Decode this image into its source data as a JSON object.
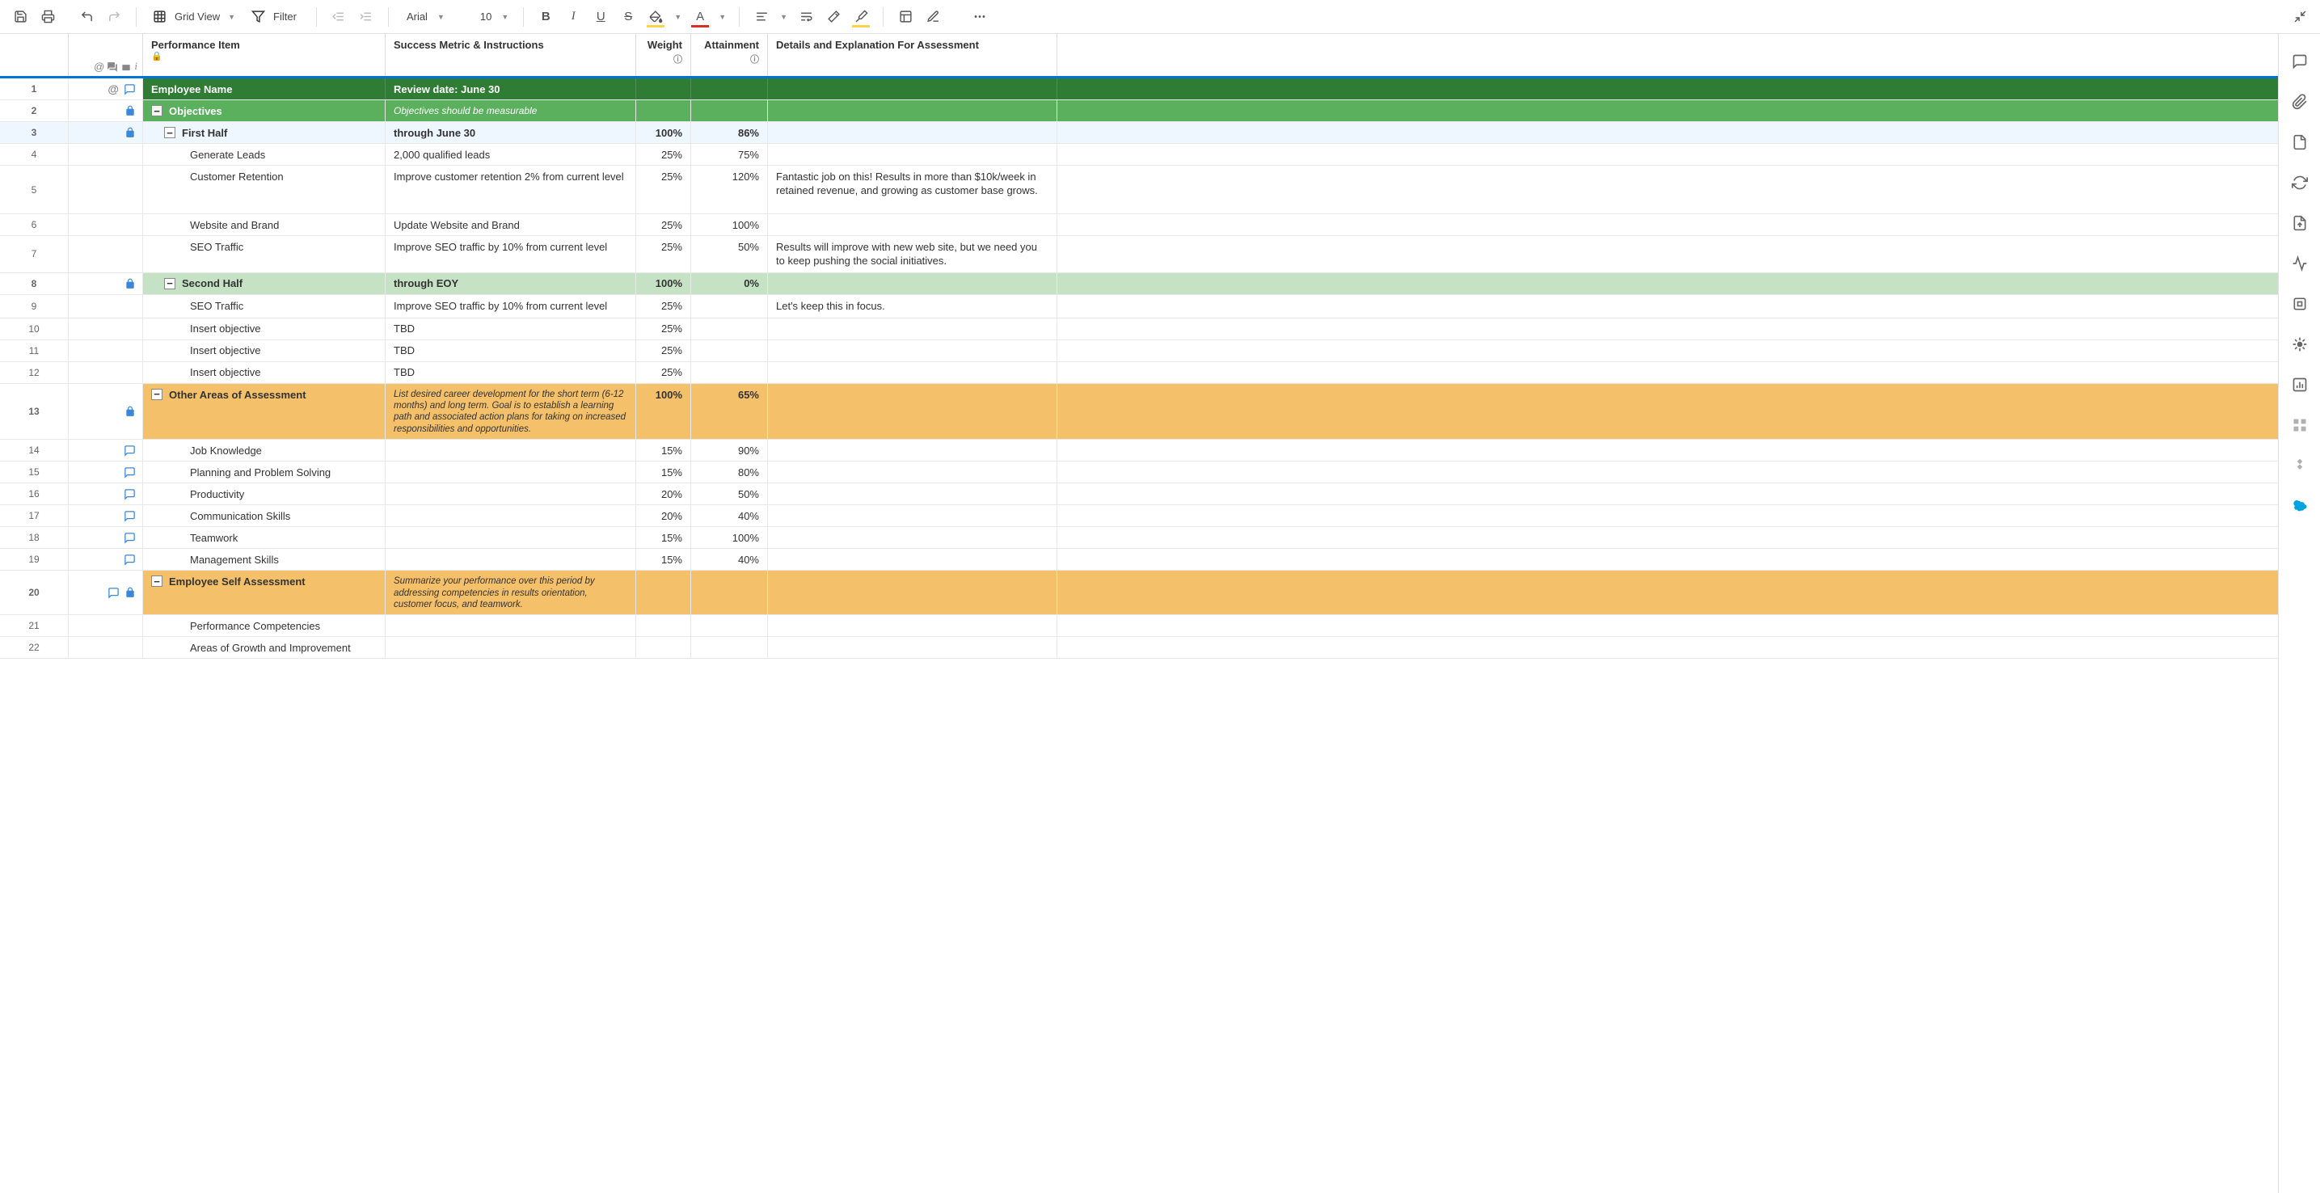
{
  "toolbar": {
    "grid_view": "Grid View",
    "filter": "Filter",
    "font": "Arial",
    "font_size": "10"
  },
  "headers": {
    "performance_item": "Performance Item",
    "success_metric": "Success Metric & Instructions",
    "weight": "Weight",
    "attainment": "Attainment",
    "details": "Details and Explanation For Assessment"
  },
  "rows": [
    {
      "n": 1,
      "perf": "Employee Name",
      "metric": "Review date: June 30",
      "weight": "",
      "attain": "",
      "details": "",
      "bg": "darkgreen",
      "indent": 1,
      "collapse": false,
      "icons": [
        "mention",
        "comment"
      ],
      "lock": false
    },
    {
      "n": 2,
      "perf": "Objectives",
      "metric": "Objectives should be measurable",
      "weight": "",
      "attain": "",
      "details": "",
      "bg": "green",
      "indent": 1,
      "collapse": true,
      "icons": [],
      "lock": true
    },
    {
      "n": 3,
      "perf": "First Half",
      "metric": "through June 30",
      "weight": "100%",
      "attain": "86%",
      "details": "",
      "bg": "lightgreen",
      "indent": 2,
      "collapse": true,
      "icons": [],
      "lock": true,
      "selected": true
    },
    {
      "n": 4,
      "perf": "Generate Leads",
      "metric": "2,000 qualified leads",
      "weight": "25%",
      "attain": "75%",
      "details": "",
      "bg": "",
      "indent": 3,
      "collapse": false,
      "icons": [],
      "lock": false
    },
    {
      "n": 5,
      "perf": "Customer Retention",
      "metric": "Improve customer retention 2% from current level",
      "weight": "25%",
      "attain": "120%",
      "details": "Fantastic job on this! Results in more than $10k/week in retained revenue, and growing as customer base grows.",
      "bg": "",
      "indent": 3,
      "collapse": false,
      "icons": [],
      "lock": false,
      "tall": "taller"
    },
    {
      "n": 6,
      "perf": "Website and Brand",
      "metric": "Update Website and Brand",
      "weight": "25%",
      "attain": "100%",
      "details": "",
      "bg": "",
      "indent": 3,
      "collapse": false,
      "icons": [],
      "lock": false
    },
    {
      "n": 7,
      "perf": "SEO Traffic",
      "metric": "Improve SEO traffic by 10% from current level",
      "weight": "25%",
      "attain": "50%",
      "details": "Results will improve with new web site, but we need you to keep pushing the social initiatives.",
      "bg": "",
      "indent": 3,
      "collapse": false,
      "icons": [],
      "lock": false,
      "tall": "tall"
    },
    {
      "n": 8,
      "perf": "Second Half",
      "metric": "through EOY",
      "weight": "100%",
      "attain": "0%",
      "details": "",
      "bg": "lightgreen",
      "indent": 2,
      "collapse": true,
      "icons": [],
      "lock": true
    },
    {
      "n": 9,
      "perf": "SEO Traffic",
      "metric": "Improve SEO traffic by 10% from current level",
      "weight": "25%",
      "attain": "",
      "details": "Let's keep this in focus.",
      "bg": "",
      "indent": 3,
      "collapse": false,
      "icons": [],
      "lock": false
    },
    {
      "n": 10,
      "perf": "Insert objective",
      "metric": "TBD",
      "weight": "25%",
      "attain": "",
      "details": "",
      "bg": "",
      "indent": 3,
      "collapse": false,
      "icons": [],
      "lock": false
    },
    {
      "n": 11,
      "perf": "Insert objective",
      "metric": "TBD",
      "weight": "25%",
      "attain": "",
      "details": "",
      "bg": "",
      "indent": 3,
      "collapse": false,
      "icons": [],
      "lock": false
    },
    {
      "n": 12,
      "perf": "Insert objective",
      "metric": "TBD",
      "weight": "25%",
      "attain": "",
      "details": "",
      "bg": "",
      "indent": 3,
      "collapse": false,
      "icons": [],
      "lock": false
    },
    {
      "n": 13,
      "perf": "Other Areas of Assessment",
      "metric": "List desired career development for the short term (6-12 months) and long term. Goal is to establish a learning path and associated action plans for taking on increased responsibilities and opportunities.",
      "weight": "100%",
      "attain": "65%",
      "details": "",
      "bg": "orange",
      "indent": 1,
      "collapse": true,
      "icons": [],
      "lock": true,
      "tall": "taller"
    },
    {
      "n": 14,
      "perf": "Job Knowledge",
      "metric": "",
      "weight": "15%",
      "attain": "90%",
      "details": "",
      "bg": "",
      "indent": 3,
      "collapse": false,
      "icons": [
        "comment"
      ],
      "lock": false
    },
    {
      "n": 15,
      "perf": "Planning and Problem Solving",
      "metric": "",
      "weight": "15%",
      "attain": "80%",
      "details": "",
      "bg": "",
      "indent": 3,
      "collapse": false,
      "icons": [
        "comment"
      ],
      "lock": false
    },
    {
      "n": 16,
      "perf": "Productivity",
      "metric": "",
      "weight": "20%",
      "attain": "50%",
      "details": "",
      "bg": "",
      "indent": 3,
      "collapse": false,
      "icons": [
        "comment"
      ],
      "lock": false
    },
    {
      "n": 17,
      "perf": "Communication Skills",
      "metric": "",
      "weight": "20%",
      "attain": "40%",
      "details": "",
      "bg": "",
      "indent": 3,
      "collapse": false,
      "icons": [
        "comment"
      ],
      "lock": false
    },
    {
      "n": 18,
      "perf": "Teamwork",
      "metric": "",
      "weight": "15%",
      "attain": "100%",
      "details": "",
      "bg": "",
      "indent": 3,
      "collapse": false,
      "icons": [
        "comment"
      ],
      "lock": false
    },
    {
      "n": 19,
      "perf": "Management Skills",
      "metric": "",
      "weight": "15%",
      "attain": "40%",
      "details": "",
      "bg": "",
      "indent": 3,
      "collapse": false,
      "icons": [
        "comment"
      ],
      "lock": false
    },
    {
      "n": 20,
      "perf": "Employee Self Assessment",
      "metric": "Summarize your performance over this period by addressing competencies in results orientation, customer focus, and teamwork.",
      "weight": "",
      "attain": "",
      "details": "",
      "bg": "orange",
      "indent": 1,
      "collapse": true,
      "icons": [
        "comment"
      ],
      "lock": true,
      "tall": "tall"
    },
    {
      "n": 21,
      "perf": "Performance Competencies",
      "metric": "",
      "weight": "",
      "attain": "",
      "details": "",
      "bg": "",
      "indent": 3,
      "collapse": false,
      "icons": [],
      "lock": false
    },
    {
      "n": 22,
      "perf": "Areas of Growth and Improvement",
      "metric": "",
      "weight": "",
      "attain": "",
      "details": "",
      "bg": "",
      "indent": 3,
      "collapse": false,
      "icons": [],
      "lock": false
    }
  ]
}
